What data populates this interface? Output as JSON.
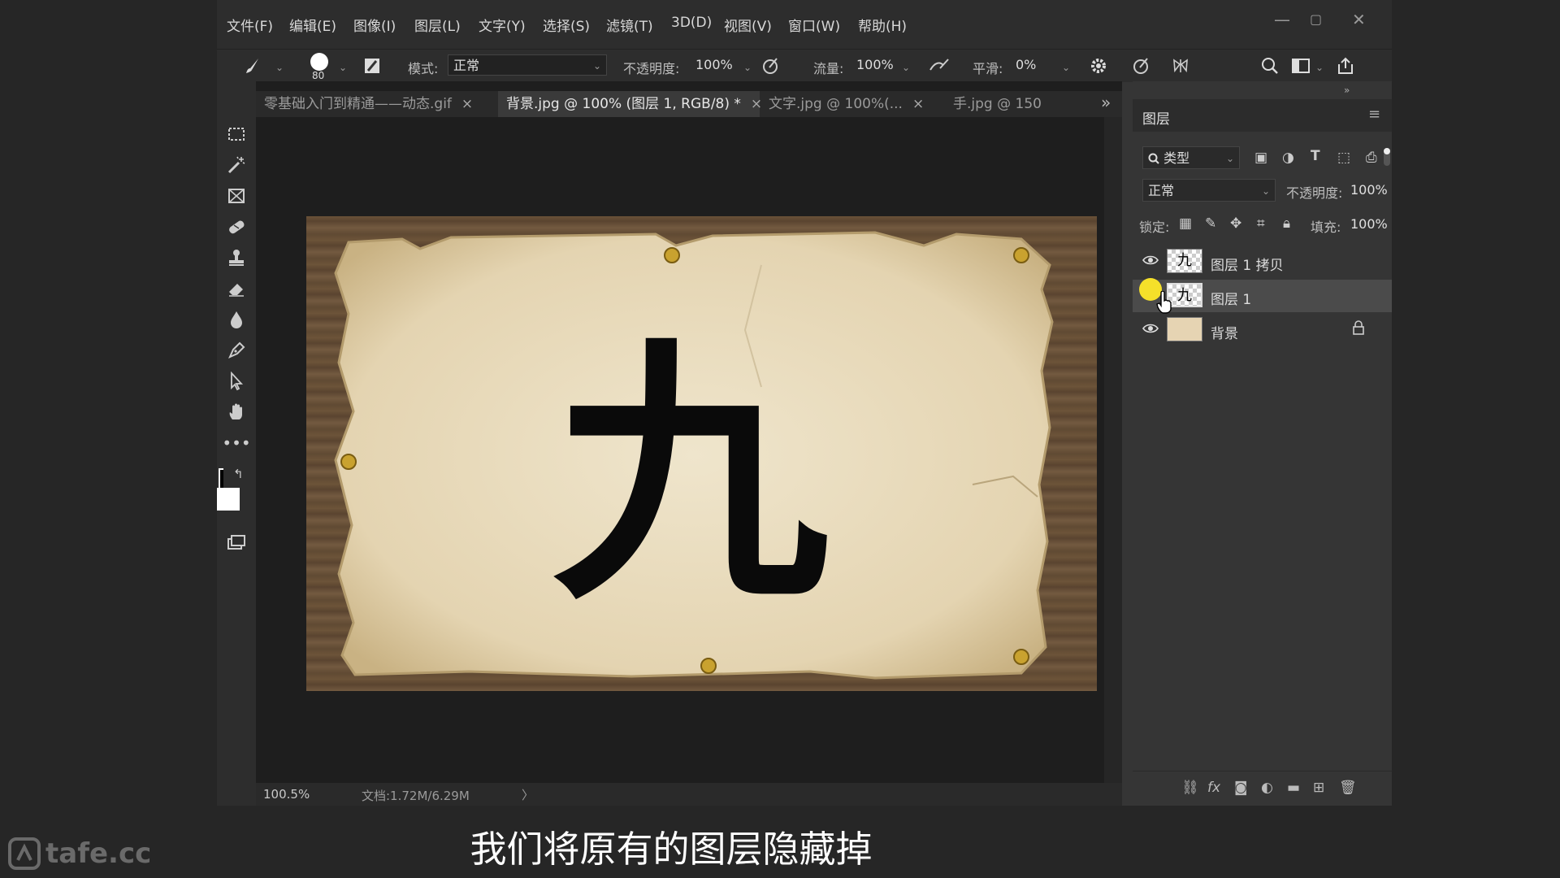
{
  "menu": [
    "文件(F)",
    "编辑(E)",
    "图像(I)",
    "图层(L)",
    "文字(Y)",
    "选择(S)",
    "滤镜(T)",
    "3D(D)",
    "视图(V)",
    "窗口(W)",
    "帮助(H)"
  ],
  "options": {
    "brush_size": "80",
    "mode_label": "模式:",
    "mode_value": "正常",
    "opacity_label": "不透明度:",
    "opacity_value": "100%",
    "flow_label": "流量:",
    "flow_value": "100%",
    "smooth_label": "平滑:",
    "smooth_value": "0%"
  },
  "tabs": [
    {
      "label": "零基础入门到精通——动态.gif",
      "close": "×"
    },
    {
      "label": "背景.jpg @ 100% (图层 1, RGB/8) *",
      "close": "×"
    },
    {
      "label": "文字.jpg @ 100%(...",
      "close": "×"
    },
    {
      "label": "手.jpg @ 150",
      "close": ""
    }
  ],
  "tabs_more": "»",
  "canvas": {
    "glyph": "九",
    "paper_color": "#e8dcc0"
  },
  "status": {
    "zoom": "100.5%",
    "doc": "文档:1.72M/6.29M",
    "arrow": "〉"
  },
  "layers_panel": {
    "title": "图层",
    "filter": "类型",
    "blend": "正常",
    "opacity_label": "不透明度:",
    "opacity_value": "100%",
    "lock_label": "锁定:",
    "fill_label": "填充:",
    "fill_value": "100%",
    "layers": [
      {
        "name": "图层 1 拷贝",
        "visible": true,
        "selected": false
      },
      {
        "name": "图层 1",
        "visible": false,
        "selected": true
      },
      {
        "name": "背景",
        "visible": true,
        "selected": false,
        "locked": true
      }
    ]
  },
  "subtitle": "我们将原有的图层隐藏掉",
  "watermark": "tafe.cc"
}
